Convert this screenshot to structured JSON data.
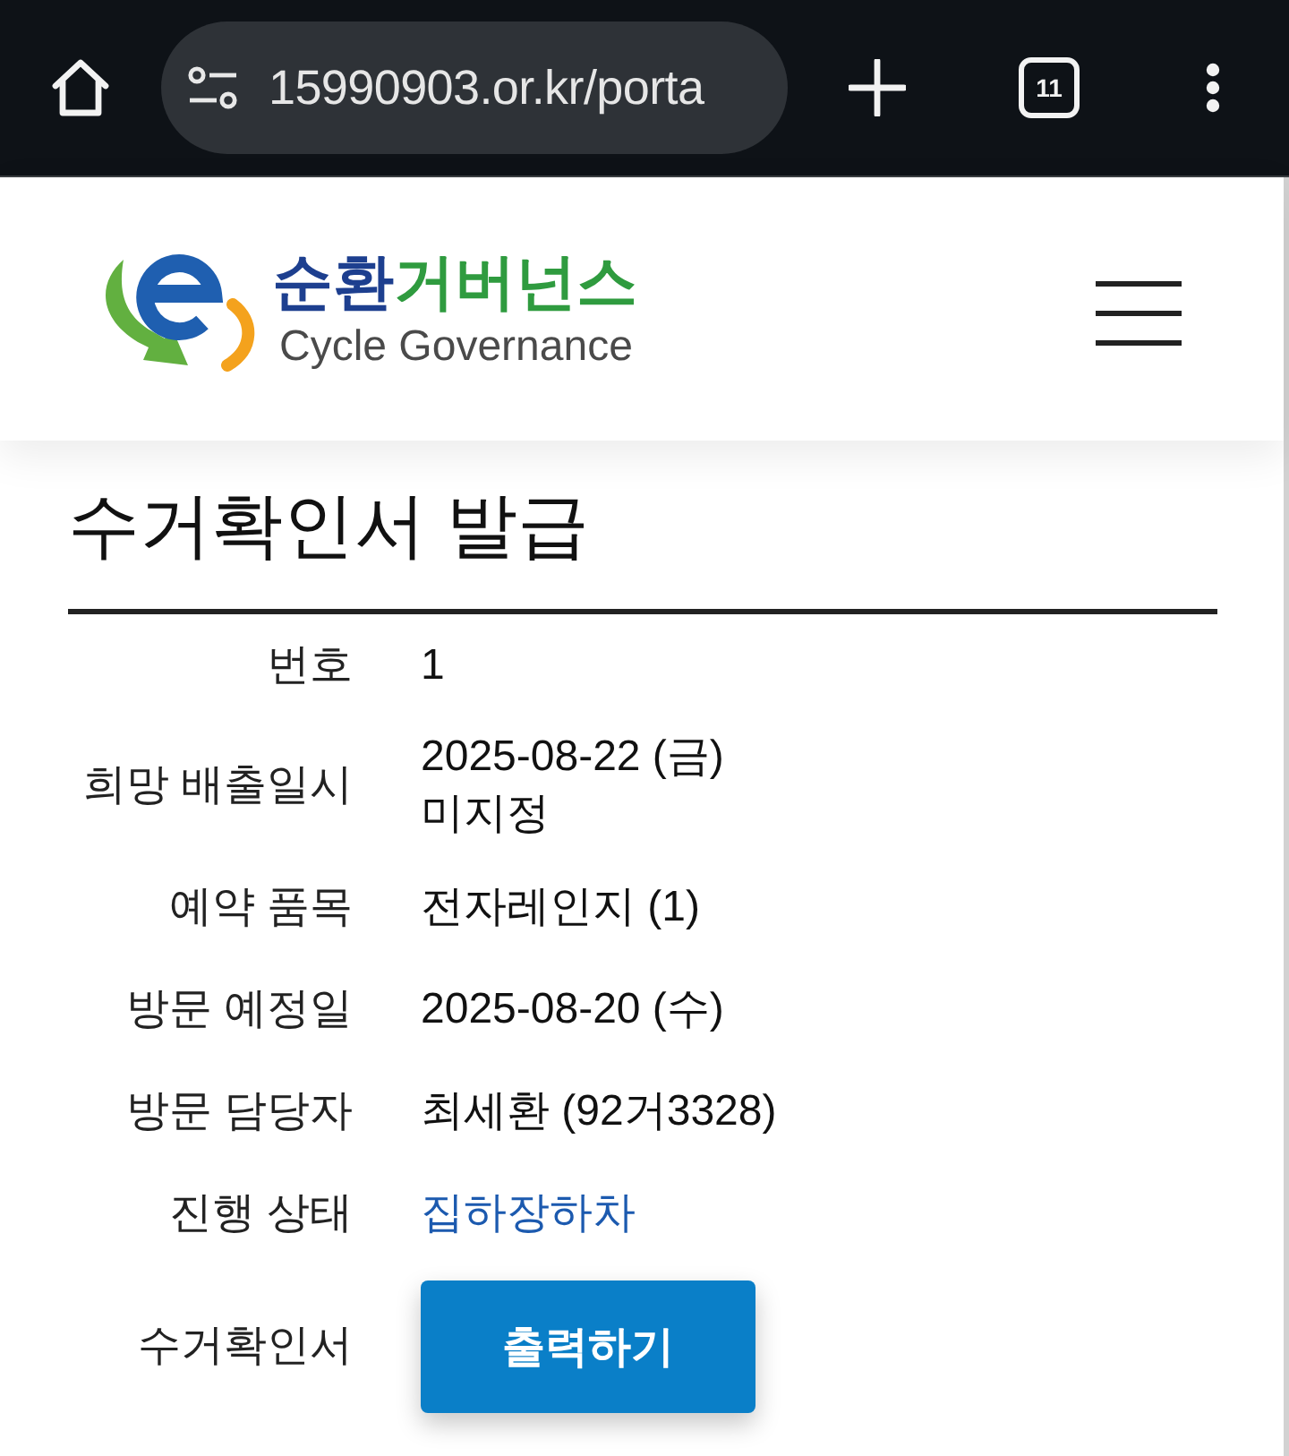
{
  "browser": {
    "url": "15990903.or.kr/porta",
    "tab_count": "11"
  },
  "header": {
    "logo": {
      "wordmark": [
        {
          "text": "순환",
          "color": "#1d3f8f"
        },
        {
          "text": "거버넌스",
          "color": "#2f9b3f"
        }
      ],
      "tagline": "Cycle Governance"
    }
  },
  "page": {
    "title": "수거확인서 발급",
    "fields": [
      {
        "kind": "text",
        "label": "번호",
        "values": [
          "1"
        ]
      },
      {
        "kind": "text",
        "label": "희망 배출일시",
        "values": [
          "2025-08-22 (금)",
          "미지정"
        ]
      },
      {
        "kind": "text",
        "label": "예약 품목",
        "values": [
          "전자레인지 (1)"
        ]
      },
      {
        "kind": "text",
        "label": "방문 예정일",
        "values": [
          "2025-08-20 (수)"
        ]
      },
      {
        "kind": "text",
        "label": "방문 담당자",
        "values": [
          "최세환 (92거3328)"
        ]
      },
      {
        "kind": "status",
        "label": "진행 상태",
        "values": [
          "집하장하차"
        ]
      },
      {
        "kind": "button",
        "label": "수거확인서",
        "button": "출력하기"
      }
    ]
  }
}
